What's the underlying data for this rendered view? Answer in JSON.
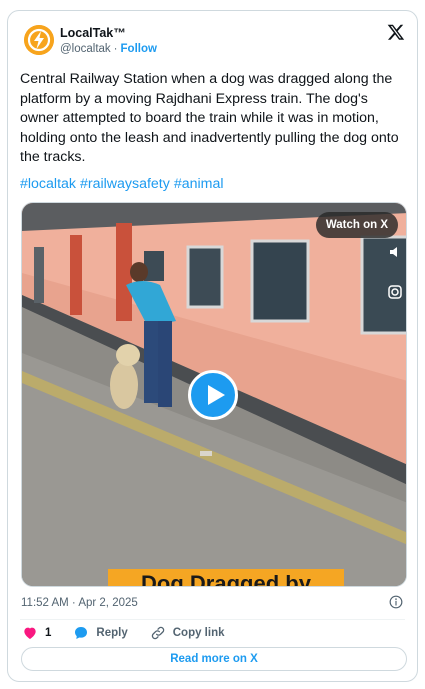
{
  "account": {
    "name": "LocalTak™",
    "handle": "@localtak",
    "separator": "·",
    "follow_label": "Follow",
    "avatar_icon": "lightning-bolt-logo",
    "avatar_color": "#f7a41d"
  },
  "tweet": {
    "text": "Central Railway Station when a dog was dragged along the platform by a moving Rajdhani Express train. The dog's owner attempted to board the train while it was in motion, holding onto the leash and inadvertently pulling the dog onto the tracks.",
    "hashtags": [
      "#localtak",
      "#railwaysafety",
      "#animal"
    ]
  },
  "media": {
    "watch_label": "Watch on X",
    "caption_text": "Dog Dragged by",
    "play_icon": "play-icon"
  },
  "footer": {
    "timestamp": "11:52 AM · Apr 2, 2025",
    "like_count": "1",
    "reply_label": "Reply",
    "copy_link_label": "Copy link",
    "read_more_label": "Read more on X"
  },
  "colors": {
    "accent": "#1d9bf0",
    "like": "#f91880",
    "muted_text": "#536471",
    "border": "#cfd9de"
  }
}
